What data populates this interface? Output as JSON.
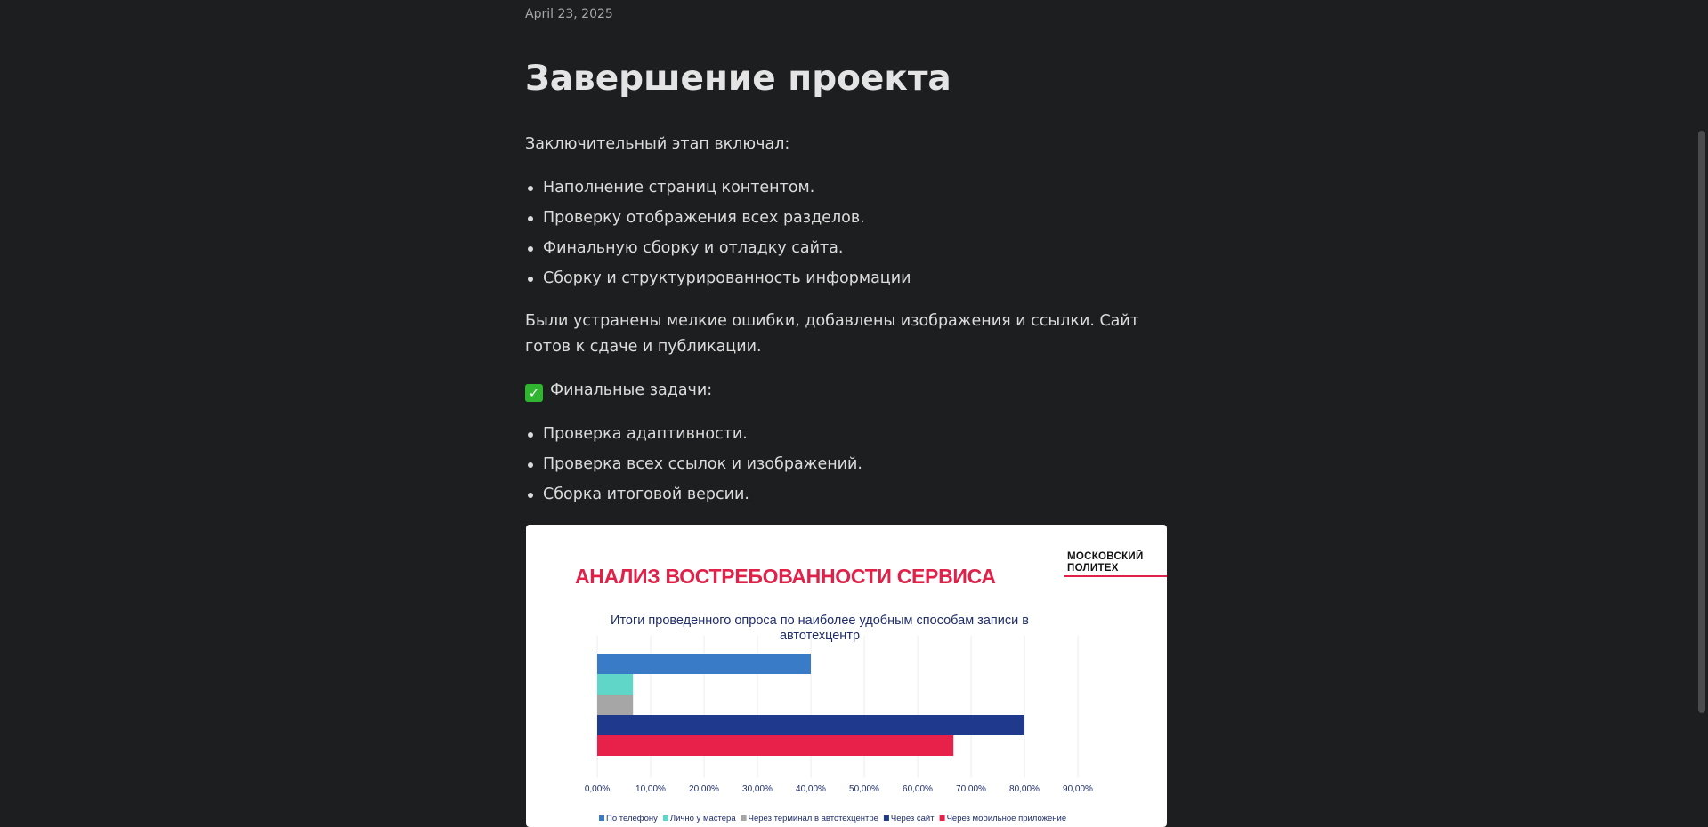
{
  "post": {
    "date": "April 23, 2025",
    "title": "Завершение проекта",
    "intro": "Заключительный этап включал:",
    "steps": [
      "Наполнение страниц контентом.",
      "Проверку отображения всех разделов.",
      "Финальную сборку и отладку сайта.",
      "Сборку и структурированность информации"
    ],
    "summary": "Были устранены мелкие ошибки, добавлены изображения и ссылки. Сайт готов к сдаче и публикации.",
    "tasks_heading": "Финальные задачи:",
    "tasks_icon": "check-mark-button-icon",
    "tasks": [
      "Проверка адаптивности.",
      "Проверка всех ссылок и изображений.",
      "Сборка итоговой версии."
    ]
  },
  "slide": {
    "title": "АНАЛИЗ ВОСТРЕБОВАННОСТИ СЕРВИСА",
    "logo_line1": "МОСКОВСКИЙ",
    "logo_line2": "ПОЛИТЕХ",
    "accent_color": "#e0224a"
  },
  "chart_data": {
    "type": "bar",
    "orientation": "horizontal",
    "title": "Итоги проведенного опроса по наиболее удобным способам записи в автотехцентр",
    "series": [
      {
        "name": "По телефону",
        "value": 40,
        "color": "#3a7bc8"
      },
      {
        "name": "Лично у мастера",
        "value": 6.7,
        "color": "#5fd6c8"
      },
      {
        "name": "Через терминал в автотехцентре",
        "value": 6.7,
        "color": "#a6a6a6"
      },
      {
        "name": "Через сайт",
        "value": 80,
        "color": "#1f3a8c"
      },
      {
        "name": "Через мобильное приложение",
        "value": 66.7,
        "color": "#e8214b"
      }
    ],
    "xlim": [
      0,
      90
    ],
    "ticks": [
      "0,00%",
      "10,00%",
      "20,00%",
      "30,00%",
      "40,00%",
      "50,00%",
      "60,00%",
      "70,00%",
      "80,00%",
      "90,00%"
    ],
    "tick_values": [
      0,
      10,
      20,
      30,
      40,
      50,
      60,
      70,
      80,
      90
    ],
    "grid": true,
    "legend": "bottom"
  }
}
